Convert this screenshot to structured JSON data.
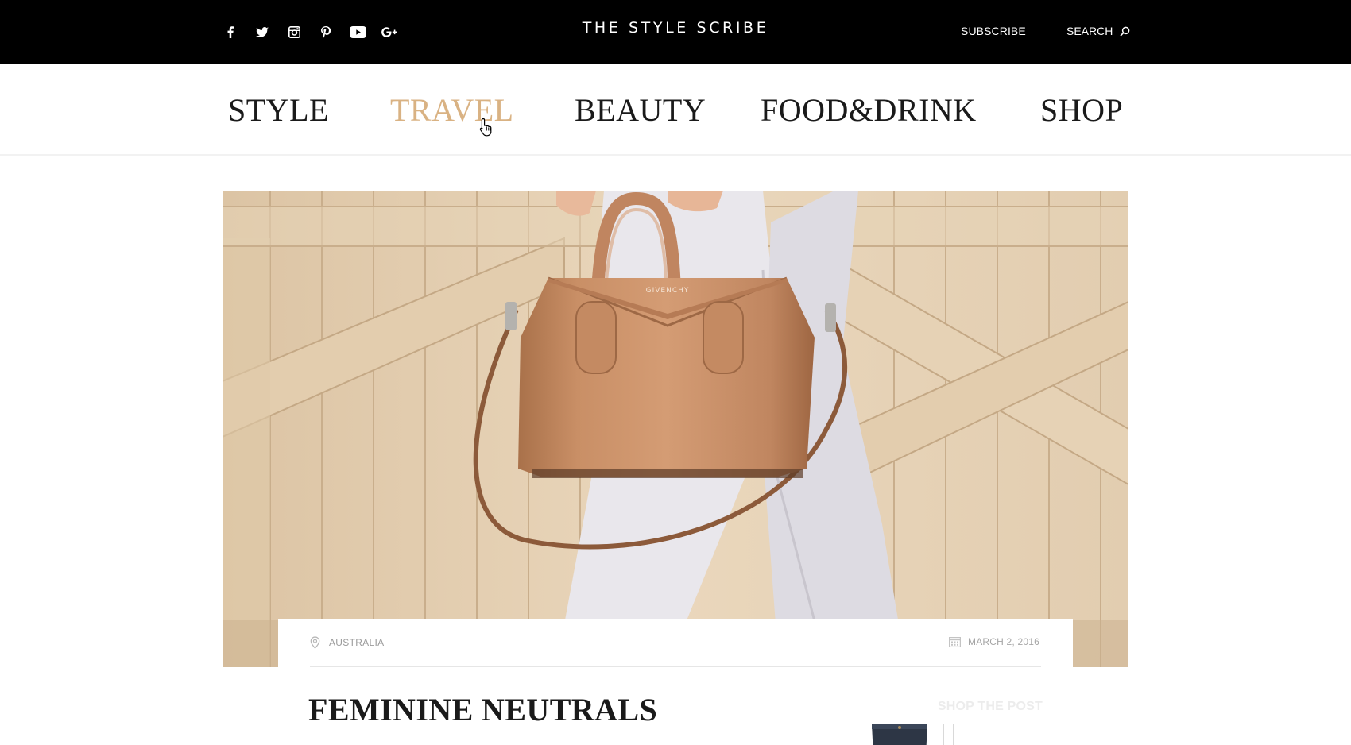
{
  "header": {
    "brand": "THE STYLE SCRIBE",
    "subscribe_label": "SUBSCRIBE",
    "search_label": "SEARCH",
    "social_icons": [
      "facebook-icon",
      "twitter-icon",
      "instagram-icon",
      "pinterest-icon",
      "youtube-icon",
      "google-plus-icon"
    ],
    "background_color": "#000000"
  },
  "nav": {
    "items": [
      {
        "label": "STYLE",
        "active": false
      },
      {
        "label": "TRAVEL",
        "active": true
      },
      {
        "label": "BEAUTY",
        "active": false
      },
      {
        "label": "FOOD&DRINK",
        "active": false
      },
      {
        "label": "SHOP",
        "active": false
      }
    ],
    "active_color": "#d9b283"
  },
  "hero": {
    "icon": "handbag-photo"
  },
  "post": {
    "location": "AUSTRALIA",
    "date": "MARCH 2, 2016",
    "title": "FEMININE NEUTRALS",
    "shop_label": "SHOP THE POST"
  }
}
